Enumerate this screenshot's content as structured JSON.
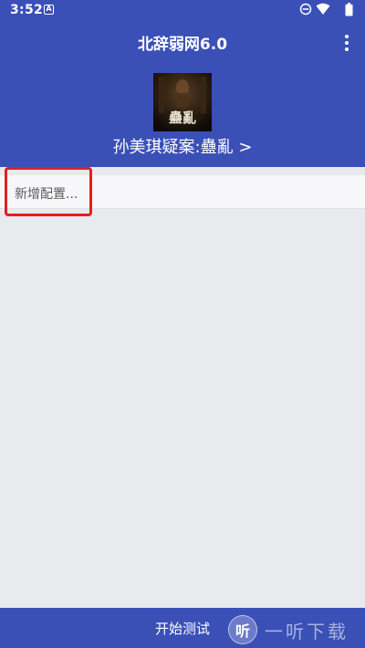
{
  "status_bar": {
    "time": "3:52",
    "notification_icon": "a-icon",
    "indicators": [
      "do-not-disturb-icon",
      "wifi-icon",
      "battery-icon"
    ]
  },
  "header": {
    "title": "北辞弱网6.0",
    "menu_icon": "more-vert-icon",
    "profile": {
      "avatar_caption": "蠱亂",
      "name": "孙美琪疑案:蠱亂 >"
    }
  },
  "config_list": {
    "add_item_label": "新增配置..."
  },
  "footer": {
    "start_button_label": "开始测试",
    "watermark": {
      "logo_char": "听",
      "text": "一听下载"
    }
  },
  "colors": {
    "primary": "#3b50b6",
    "background": "#e8eaee",
    "highlight": "#e02020"
  }
}
